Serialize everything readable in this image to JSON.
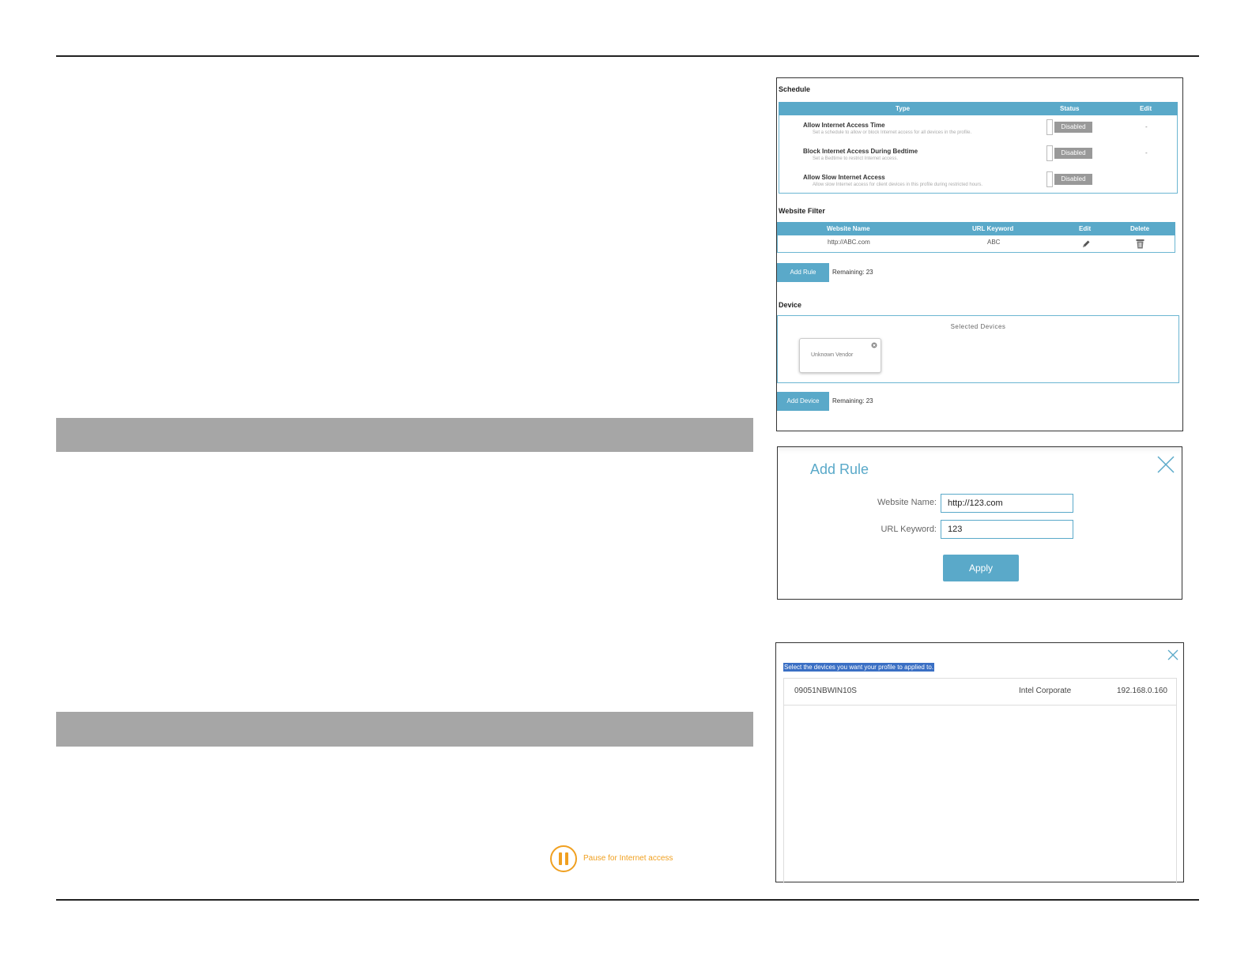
{
  "schedule": {
    "title": "Schedule",
    "headers": {
      "type": "Type",
      "status": "Status",
      "edit": "Edit"
    },
    "rows": [
      {
        "title": "Allow Internet Access Time",
        "desc": "Set a schedule to allow or block Internet access for all devices in the profile.",
        "status": "Disabled",
        "edit": "-"
      },
      {
        "title": "Block Internet Access During Bedtime",
        "desc": "Set a Bedtime to restrict Internet access.",
        "status": "Disabled",
        "edit": "-"
      },
      {
        "title": "Allow Slow Internet Access",
        "desc": "Allow slow Internet access for client devices in this profile during restricted hours.",
        "status": "Disabled",
        "edit": ""
      }
    ]
  },
  "website_filter": {
    "title": "Website Filter",
    "headers": {
      "name": "Website Name",
      "keyword": "URL Keyword",
      "edit": "Edit",
      "delete": "Delete"
    },
    "rows": [
      {
        "name": "http://ABC.com",
        "keyword": "ABC"
      }
    ],
    "add_button": "Add Rule",
    "remaining": "Remaining: 23"
  },
  "device": {
    "title": "Device",
    "selected_label": "Selected Devices",
    "cards": [
      {
        "vendor": "Unknown Vendor"
      }
    ],
    "add_button": "Add Device",
    "remaining": "Remaining: 23"
  },
  "add_rule_dialog": {
    "title": "Add Rule",
    "website_name_label": "Website Name:",
    "website_name_value": "http://123.com",
    "url_keyword_label": "URL Keyword:",
    "url_keyword_value": "123",
    "apply_button": "Apply"
  },
  "select_device_dialog": {
    "prompt": "Select the devices you want your profile to applied to.",
    "devices": [
      {
        "name": "09051NBWIN10S",
        "vendor": "Intel Corporate",
        "ip": "192.168.0.160"
      }
    ]
  },
  "pause": {
    "label": "Pause for Internet access"
  },
  "colors": {
    "accent": "#5aa9c9",
    "pause": "#f0a020",
    "band": "#a6a6a6"
  }
}
